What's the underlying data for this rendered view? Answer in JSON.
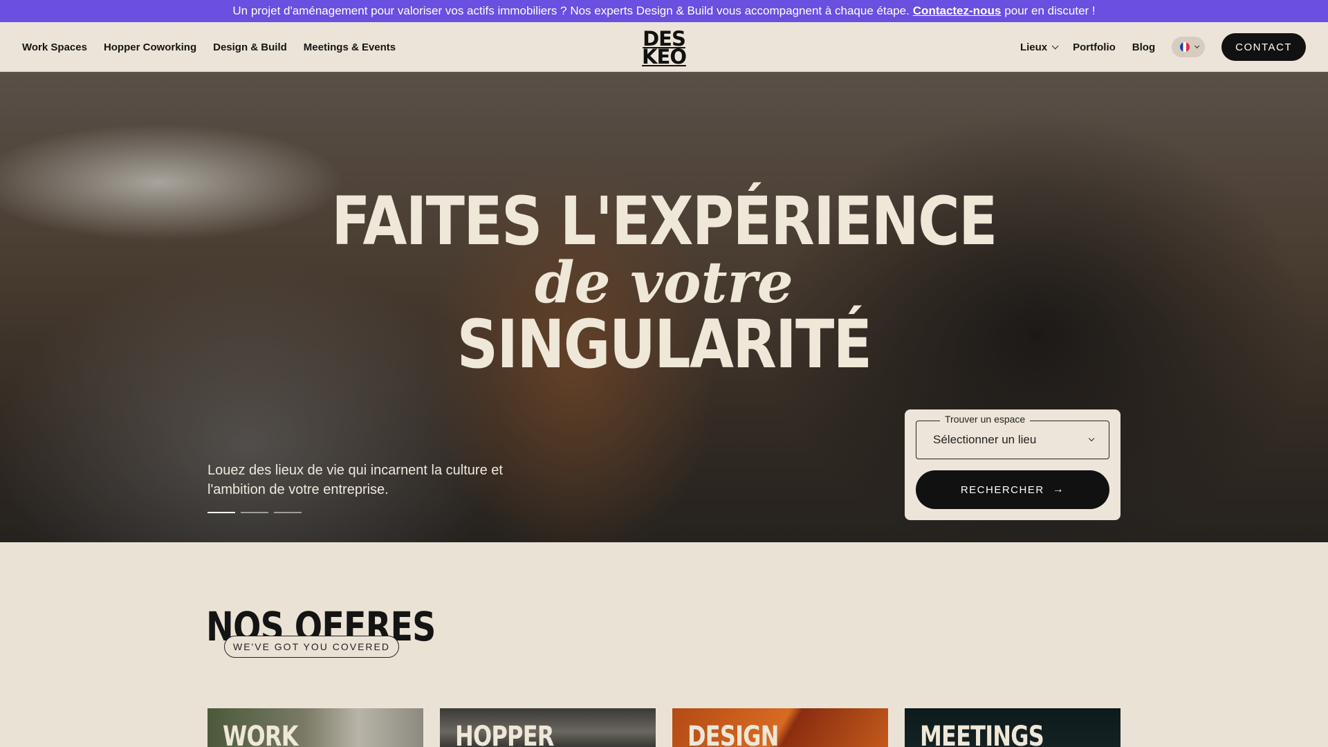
{
  "announcement": {
    "text": "Un projet d'aménagement pour valoriser vos actifs immobiliers ? Nos experts Design & Build vous accompagnent à chaque étape.",
    "link": "Contactez-nous",
    "suffix": "pour en discuter !"
  },
  "header": {
    "nav_left": [
      "Work Spaces",
      "Hopper Coworking",
      "Design & Build",
      "Meetings & Events"
    ],
    "logo_line1": "DES",
    "logo_line2": "KEO",
    "lieux": "Lieux",
    "portfolio": "Portfolio",
    "blog": "Blog",
    "contact": "CONTACT"
  },
  "hero": {
    "line1": "FAITES L'EXPÉRIENCE",
    "line2": "de votre",
    "line3": "SINGULARITÉ",
    "subtitle": "Louez des lieux de vie qui incarnent la culture et l'ambition de votre entreprise.",
    "slides": 3,
    "active_slide": 1
  },
  "search": {
    "label": "Trouver un espace",
    "value": "Sélectionner un lieu",
    "button": "RECHERCHER"
  },
  "offers": {
    "title": "NOS OFFRES",
    "badge": "WE'VE GOT YOU COVERED",
    "cards": [
      "WORK",
      "HOPPER",
      "DESIGN",
      "MEETINGS"
    ]
  }
}
